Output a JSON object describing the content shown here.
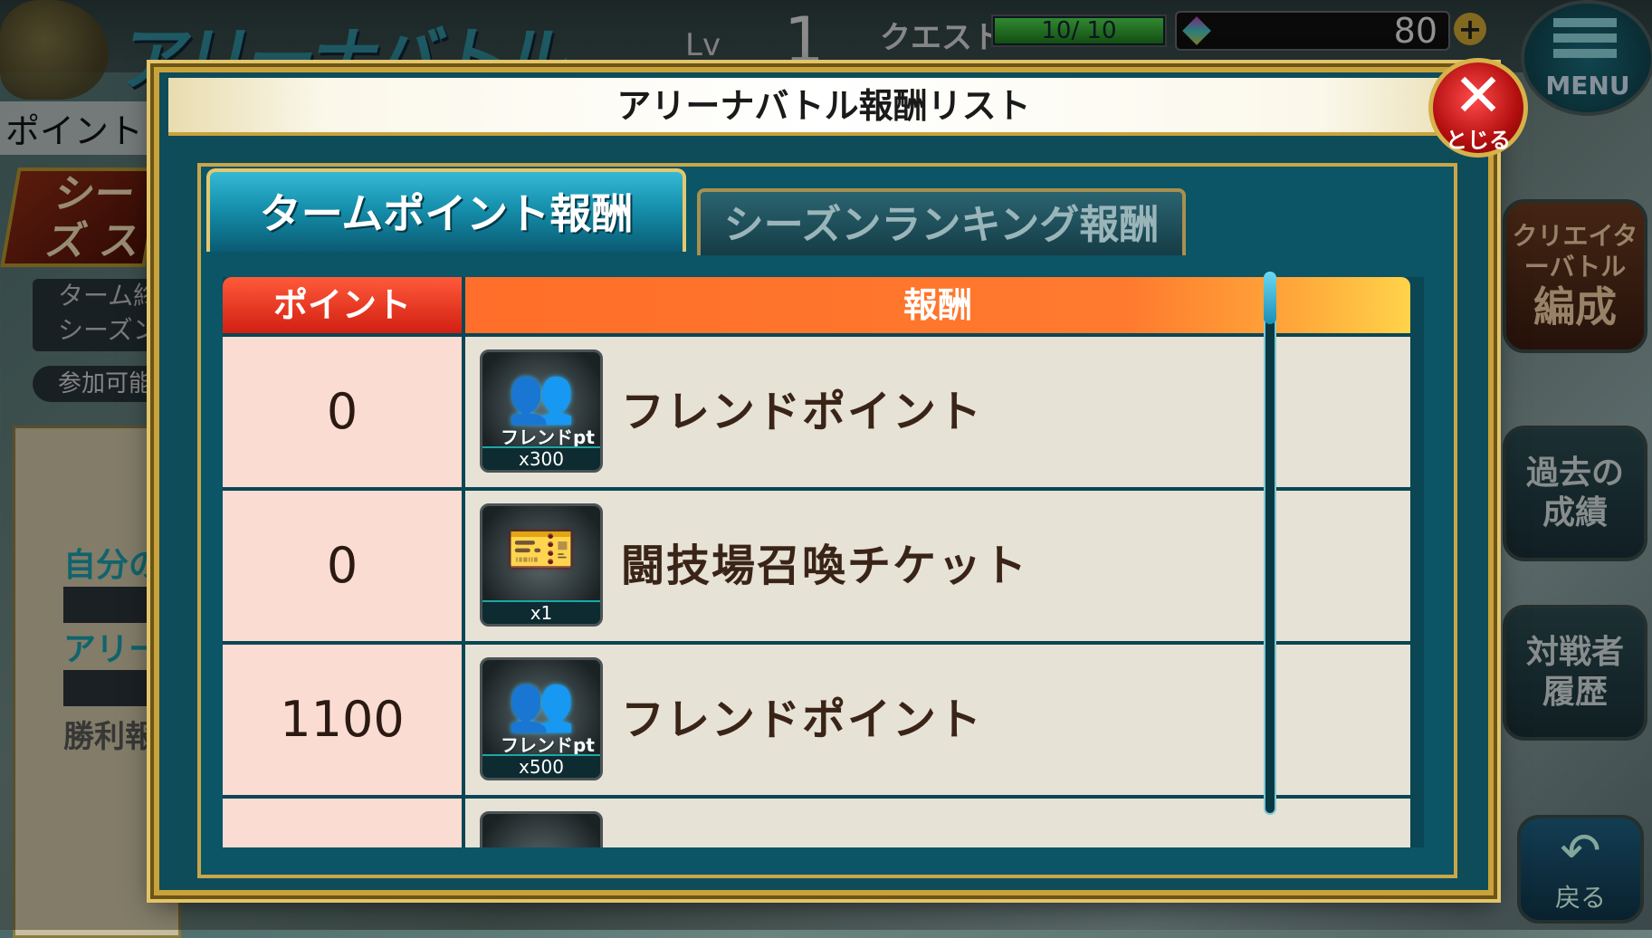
{
  "background": {
    "game_logo": "アリーナバトル",
    "lv_label": "Lv",
    "lv_value": "1",
    "quest_label": "クエスト",
    "quest_text": "10/ 10",
    "quest_progress": 1.0,
    "gem_count": "80",
    "gem_plus": "+",
    "menu_label": "MENU",
    "left_points_text": "ポイントよ",
    "season_badge": "シーズ スター",
    "term_lines": "ターム終 シーズン",
    "join_pill": "参加可能",
    "left_sub1": "自分の",
    "left_sub2": "アリー",
    "left_sub3": "勝利報",
    "side_creator_small": "クリエイターバトル",
    "side_creator_big": "編成",
    "side_past": "過去の成績",
    "side_history": "対戦者履歴",
    "back_label": "戻る"
  },
  "modal": {
    "title": "アリーナバトル報酬リスト",
    "close_label": "とじる",
    "tabs": [
      {
        "label": "タームポイント報酬",
        "active": true
      },
      {
        "label": "シーズンランキング報酬",
        "active": false
      }
    ],
    "header": {
      "point": "ポイント",
      "reward": "報酬"
    },
    "rows": [
      {
        "point": "0",
        "icon": "friend-point-icon",
        "icon_tag": "フレンドpt",
        "qty": "x300",
        "name": "フレンドポイント"
      },
      {
        "point": "0",
        "icon": "arena-ticket-icon",
        "icon_tag": "",
        "qty": "x1",
        "name": "闘技場召喚チケット"
      },
      {
        "point": "1100",
        "icon": "friend-point-icon",
        "icon_tag": "フレンドpt",
        "qty": "x500",
        "name": "フレンドポイント"
      }
    ]
  },
  "colors": {
    "header_point": "#d21f12",
    "header_reward": "#ff7a2e",
    "point_cell": "#fbdcd2",
    "reward_cell": "#e7e2d6",
    "frame_gold": "#c9a23a",
    "panel_teal": "#0e4c5a"
  }
}
